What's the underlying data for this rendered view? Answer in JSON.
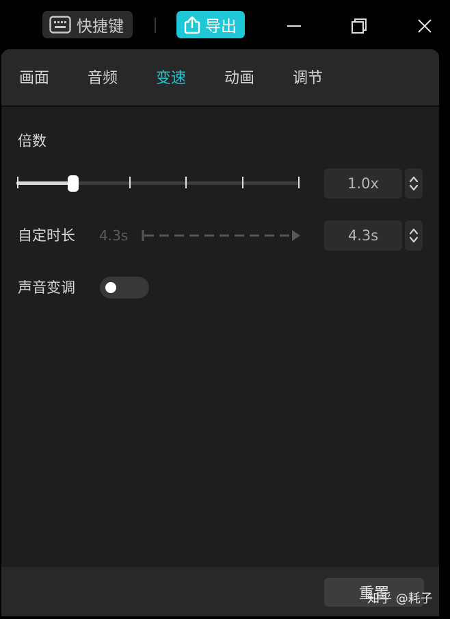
{
  "topbar": {
    "shortcut_label": "快捷键",
    "export_label": "导出",
    "icons": [
      "keyboard-icon",
      "export-icon",
      "minimize-icon",
      "restore-icon",
      "close-icon"
    ]
  },
  "tabs": [
    {
      "label": "画面",
      "active": false
    },
    {
      "label": "音频",
      "active": false
    },
    {
      "label": "变速",
      "active": true
    },
    {
      "label": "动画",
      "active": false
    },
    {
      "label": "调节",
      "active": false
    }
  ],
  "speed": {
    "multiplier_label": "倍数",
    "multiplier_value": "1.0x",
    "slider_level_fraction": 0.2,
    "custom_duration_label": "自定时长",
    "custom_duration_hint": "4.3s",
    "custom_duration_value": "4.3s",
    "pitch_label": "声音变调",
    "pitch_enabled": false
  },
  "footer": {
    "reset_label": "重置"
  },
  "watermark": "知乎 @耗子",
  "colors": {
    "accent": "#1ec8d6",
    "active_tab": "#23c2cf",
    "panel_bg": "#1e1e20"
  }
}
